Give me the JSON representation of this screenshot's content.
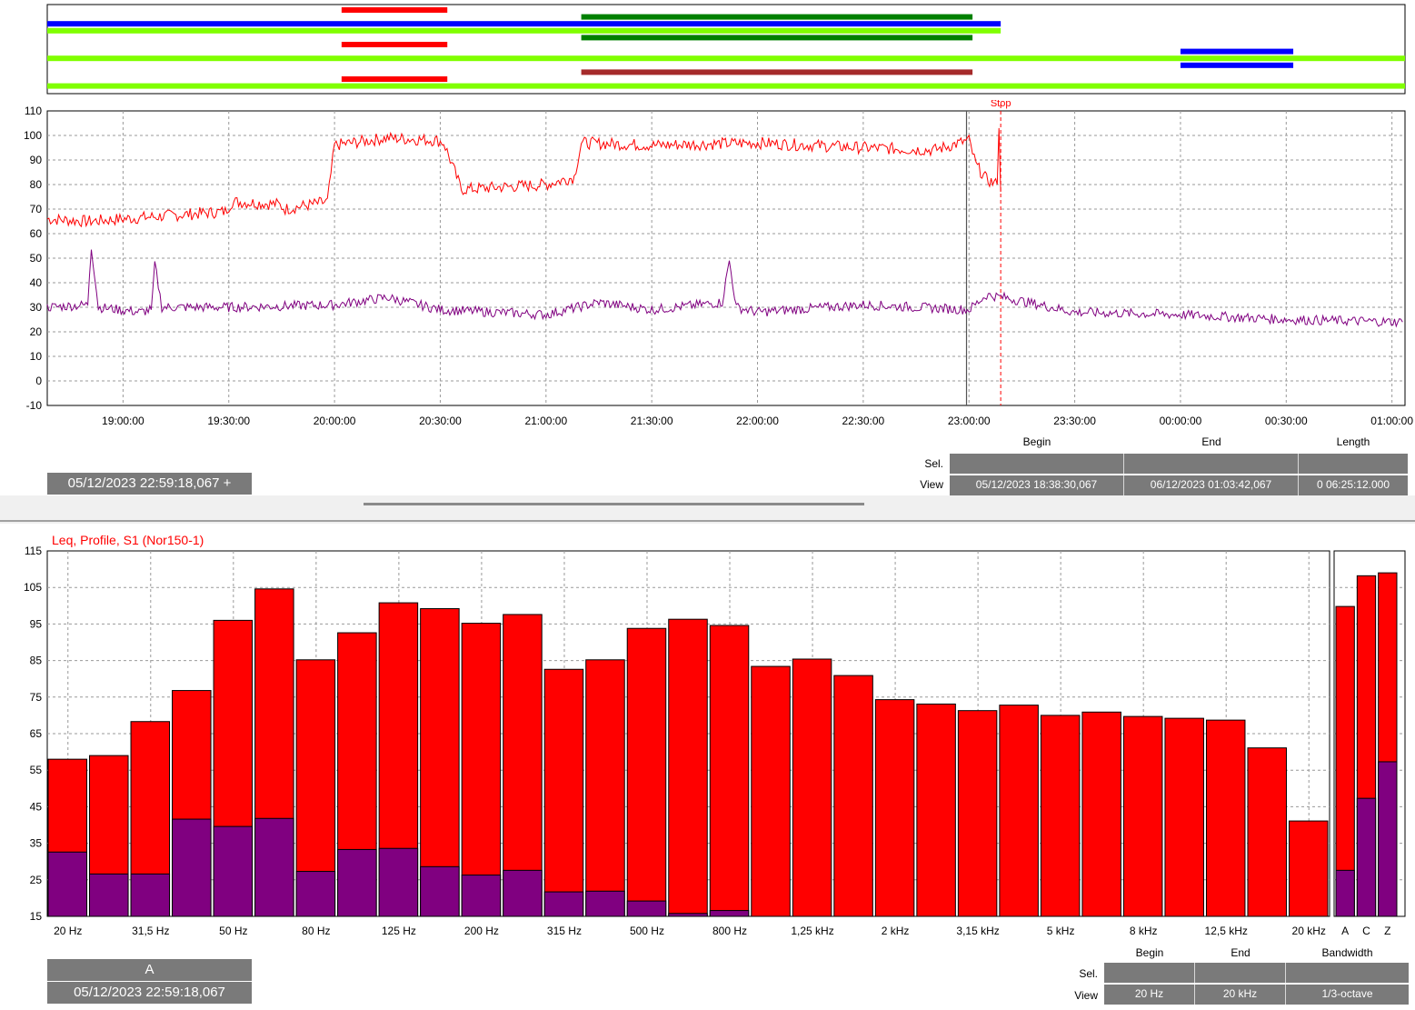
{
  "top": {
    "stop_label": "Stop",
    "cursor_timestamp": "05/12/2023 22:59:18,067 +",
    "info": {
      "col_headers": [
        "Begin",
        "End",
        "Length"
      ],
      "row_labels": [
        "Sel.",
        "View"
      ],
      "view": [
        "05/12/2023 18:38:30,067",
        "06/12/2023 01:03:42,067",
        "0 06:25:12.000"
      ]
    }
  },
  "bottom": {
    "chart_title": "Leq, Profile, S1 (Nor150-1)",
    "cursor_weighting": "A",
    "cursor_timestamp": "05/12/2023 22:59:18,067",
    "info": {
      "col_headers": [
        "Begin",
        "End",
        "Bandwidth"
      ],
      "row_labels": [
        "Sel.",
        "View"
      ],
      "view": [
        "20 Hz",
        "20 kHz",
        "1/3-octave"
      ]
    }
  },
  "colors": {
    "leq_red": "#ff0000",
    "lower_purple": "#800080",
    "event_blue": "#0000ff",
    "event_lime": "#80ff00",
    "event_green": "#008000",
    "event_darkred": "#a52a2a",
    "panel_grey": "#7a7a7a"
  },
  "chart_data": [
    {
      "type": "line",
      "x_unit": "time",
      "x_ticks": [
        "19:00:00",
        "19:30:00",
        "20:00:00",
        "20:30:00",
        "21:00:00",
        "21:30:00",
        "22:00:00",
        "22:30:00",
        "23:00:00",
        "23:30:00",
        "00:00:00",
        "00:30:00",
        "01:00:00"
      ],
      "ylim": [
        -10,
        110
      ],
      "y_ticks": [
        -10,
        0,
        10,
        20,
        30,
        40,
        50,
        60,
        70,
        80,
        90,
        100,
        110
      ],
      "grid": true,
      "series": [
        {
          "color": "#ff0000",
          "x": [
            "18:38:30",
            "18:50:00",
            "19:10:00",
            "19:29:00",
            "19:31:00",
            "19:44:00",
            "19:46:00",
            "19:58:00",
            "20:00:00",
            "20:15:00",
            "20:29:00",
            "20:31:00",
            "20:36:00",
            "21:00:00",
            "21:08:00",
            "21:10:00",
            "21:30:00",
            "22:00:00",
            "22:30:00",
            "22:50:00",
            "23:00:00",
            "23:02:00",
            "23:05:00",
            "23:08:00",
            "23:08:30",
            "23:09:00"
          ],
          "y": [
            66,
            65,
            67,
            69,
            73,
            72,
            70,
            73,
            96,
            99,
            98,
            97,
            78,
            80,
            83,
            97,
            96,
            97,
            95,
            94,
            98,
            88,
            82,
            80,
            103,
            77
          ]
        },
        {
          "color": "#800080",
          "x": [
            "18:38:30",
            "18:50:00",
            "18:51:00",
            "18:53:00",
            "19:05:00",
            "19:08:00",
            "19:09:00",
            "19:11:00",
            "19:30:00",
            "20:00:00",
            "20:15:00",
            "20:30:00",
            "21:00:00",
            "21:15:00",
            "21:30:00",
            "21:50:00",
            "21:52:00",
            "21:54:00",
            "22:00:00",
            "22:30:00",
            "23:00:00",
            "23:05:00",
            "23:10:00",
            "23:30:00",
            "00:00:00",
            "00:30:00",
            "01:03:00"
          ],
          "y": [
            30,
            31,
            55,
            30,
            28,
            29,
            48,
            30,
            30,
            31,
            34,
            29,
            27,
            32,
            29,
            32,
            49,
            30,
            28,
            31,
            29,
            35,
            34,
            28,
            27,
            25,
            24
          ]
        }
      ]
    },
    {
      "type": "bar",
      "title": "Leq, Profile, S1 (Nor150-1)",
      "ylim": [
        15,
        115
      ],
      "y_ticks": [
        15,
        25,
        35,
        45,
        55,
        65,
        75,
        85,
        95,
        105,
        115
      ],
      "grid": true,
      "categories": [
        "20 Hz",
        "25 Hz",
        "31,5 Hz",
        "40 Hz",
        "50 Hz",
        "63 Hz",
        "80 Hz",
        "100 Hz",
        "125 Hz",
        "160 Hz",
        "200 Hz",
        "250 Hz",
        "315 Hz",
        "400 Hz",
        "500 Hz",
        "630 Hz",
        "800 Hz",
        "1 kHz",
        "1,25 kHz",
        "1,6 kHz",
        "2 kHz",
        "2,5 kHz",
        "3,15 kHz",
        "4 kHz",
        "5 kHz",
        "6,3 kHz",
        "8 kHz",
        "10 kHz",
        "12,5 kHz",
        "16 kHz",
        "20 kHz"
      ],
      "tick_labels": [
        "20 Hz",
        "31,5 Hz",
        "50 Hz",
        "80 Hz",
        "125 Hz",
        "200 Hz",
        "315 Hz",
        "500 Hz",
        "800 Hz",
        "1,25 kHz",
        "2 kHz",
        "3,15 kHz",
        "5 kHz",
        "8 kHz",
        "12,5 kHz",
        "20 kHz"
      ],
      "series": [
        {
          "color": "#ff0000",
          "values": [
            58,
            59,
            68.3,
            76.8,
            96,
            104.6,
            85.2,
            92.6,
            100.8,
            99.2,
            95.2,
            97.6,
            82.6,
            85.2,
            93.8,
            96.3,
            94.6,
            0,
            83.4,
            85.4,
            80.9,
            74.3,
            73.1,
            71.3,
            72.8,
            70,
            70.9,
            69.7,
            69.2,
            68.7,
            61.1,
            41.1
          ]
        },
        {
          "color": "#800080",
          "values": [
            32.6,
            26.6,
            26.6,
            41.6,
            39.6,
            41.8,
            27.3,
            33.3,
            33.6,
            28.6,
            26.3,
            27.6,
            21.7,
            21.9,
            19.2,
            15.8,
            16.6,
            0,
            15,
            15,
            15,
            15,
            15,
            15,
            15,
            15,
            15,
            15,
            15,
            15,
            15,
            15
          ]
        }
      ],
      "overall": {
        "categories": [
          "A",
          "C",
          "Z"
        ],
        "series": [
          {
            "color": "#ff0000",
            "values": [
              99.8,
              108.2,
              109
            ]
          },
          {
            "color": "#800080",
            "values": [
              27.6,
              47.3,
              57.3
            ]
          }
        ]
      }
    }
  ],
  "event_tracks": [
    {
      "color": "#ff0000",
      "start": "20:02:00",
      "end": "20:32:00"
    },
    {
      "color": "#008000",
      "start": "21:10:00",
      "end": "23:01:00"
    },
    {
      "color": "#0000ff",
      "start": "18:38:30",
      "end": "23:09:00"
    },
    {
      "color": "#80ff00",
      "start": "18:38:30",
      "end": "23:09:00"
    },
    {
      "color": "#008000",
      "start": "21:10:00",
      "end": "23:01:00"
    },
    {
      "color": "#ff0000",
      "start": "20:02:00",
      "end": "20:32:00"
    },
    {
      "color": "#0000ff",
      "start": "00:00:00",
      "end": "00:32:00"
    },
    {
      "color": "#80ff00",
      "start": "18:38:30",
      "end": "01:03:42"
    },
    {
      "color": "#0000ff",
      "start": "00:00:00",
      "end": "00:32:00"
    },
    {
      "color": "#a52a2a",
      "start": "21:10:00",
      "end": "23:01:00"
    },
    {
      "color": "#ff0000",
      "start": "20:02:00",
      "end": "20:32:00"
    },
    {
      "color": "#80ff00",
      "start": "18:38:30",
      "end": "01:03:42"
    }
  ]
}
